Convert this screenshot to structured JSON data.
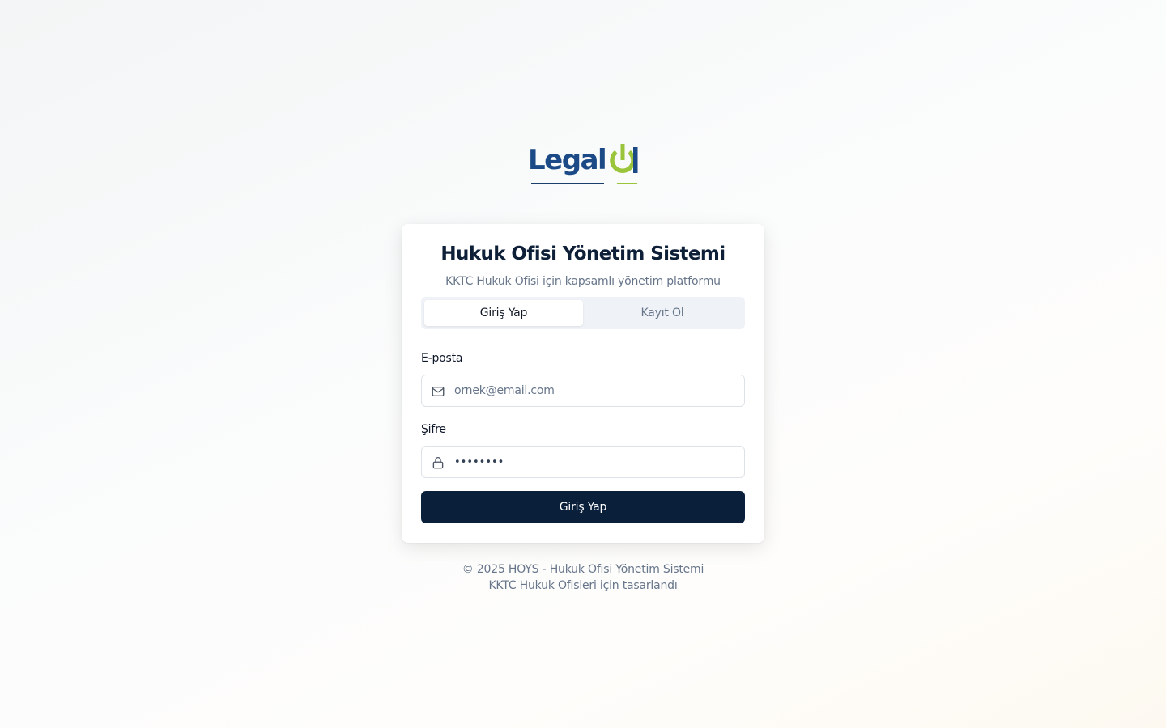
{
  "logo": {
    "text": "Legal",
    "brand_color": "#1b4a86",
    "accent_color": "#9ac43a",
    "mark": "power-icon"
  },
  "card": {
    "title": "Hukuk Ofisi Yönetim Sistemi",
    "subtitle": "KKTC Hukuk Ofisi için kapsamlı yönetim platformu"
  },
  "tabs": [
    {
      "label": "Giriş Yap",
      "active": true
    },
    {
      "label": "Kayıt Ol",
      "active": false
    }
  ],
  "form": {
    "email_label": "E-posta",
    "email_placeholder": "ornek@email.com",
    "email_value": "",
    "email_icon": "mail-icon",
    "password_label": "Şifre",
    "password_value": "••••••••",
    "password_icon": "lock-icon",
    "submit_label": "Giriş Yap",
    "submit_color": "#0a1f3a"
  },
  "footer": {
    "line1": "© 2025 HOYS - Hukuk Ofisi Yönetim Sistemi",
    "line2": "KKTC Hukuk Ofisleri için tasarlandı"
  }
}
